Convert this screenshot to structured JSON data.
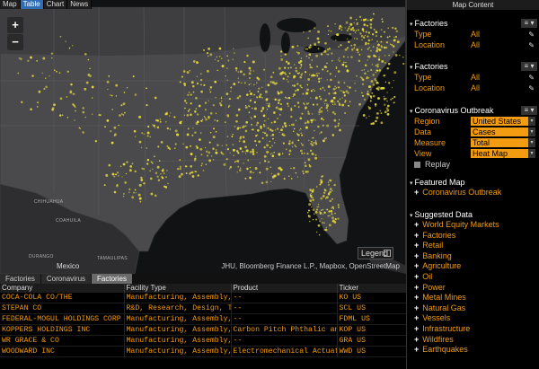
{
  "top_tabs": [
    "Map",
    "Table",
    "Chart",
    "News"
  ],
  "map": {
    "labels": {
      "mexico": "Mexico",
      "legend": "Legend",
      "attribution": "JHU, Bloomberg Finance L.P., Mapbox, OpenStreetMap",
      "chihuahua": "CHIHUAHUA",
      "coahuila": "COAHUILA",
      "durango": "DURANGO",
      "tamaulipas": "TAMAULIPAS"
    },
    "zoom_in": "+",
    "zoom_out": "−"
  },
  "bottom": {
    "tabs": [
      "Factories",
      "Coronavirus",
      "Factories"
    ],
    "columns": [
      "Company",
      "Facility Type",
      "Product",
      "Ticker"
    ],
    "rows": [
      {
        "company": "COCA-COLA CO/THE",
        "facility": "Manufacturing, Assembly, …",
        "product": "--",
        "ticker": "KO US"
      },
      {
        "company": "STEPAN CO",
        "facility": "R&D, Research, Design, Te…",
        "product": "--",
        "ticker": "SCL US"
      },
      {
        "company": "FEDERAL-MOGUL HOLDINGS CORP",
        "facility": "Manufacturing, Assembly, …",
        "product": "--",
        "ticker": "FDML US"
      },
      {
        "company": "KOPPERS HOLDINGS INC",
        "facility": "Manufacturing, Assembly, …",
        "product": "Carbon Pitch Phthalic anh…",
        "ticker": "KOP US"
      },
      {
        "company": "WR GRACE & CO",
        "facility": "Manufacturing, Assembly, …",
        "product": "--",
        "ticker": "GRA US"
      },
      {
        "company": "WOODWARD INC",
        "facility": "Manufacturing, Assembly, …",
        "product": "Electromechanical Actuato…",
        "ticker": "WWD US"
      }
    ]
  },
  "panel": {
    "title": "Map Content",
    "factories1": {
      "title": "Factories",
      "type_label": "Type",
      "type_value": "All",
      "location_label": "Location",
      "location_value": "All"
    },
    "factories2": {
      "title": "Factories",
      "type_label": "Type",
      "type_value": "All",
      "location_label": "Location",
      "location_value": "All"
    },
    "corona": {
      "title": "Coronavirus Outbreak",
      "region_label": "Region",
      "region_value": "United States",
      "data_label": "Data",
      "data_value": "Cases",
      "measure_label": "Measure",
      "measure_value": "Total",
      "view_label": "View",
      "view_value": "Heat Map",
      "replay": "Replay"
    },
    "featured": {
      "title": "Featured Map",
      "items": [
        "Coronavirus Outbreak"
      ]
    },
    "suggested": {
      "title": "Suggested Data",
      "items": [
        "World Equity Markets",
        "Factories",
        "Retail",
        "Banking",
        "Agriculture",
        "Oil",
        "Power",
        "Metal Mines",
        "Natural Gas",
        "Vessels",
        "Infrastructure",
        "Wildfires",
        "Earthquakes"
      ]
    },
    "menu_icon": "≡ ▾",
    "edit_icon": "✎"
  },
  "colors": {
    "accent": "#f39c12",
    "tab_active": "#2f6db5",
    "dots": "#e8dc3a"
  }
}
